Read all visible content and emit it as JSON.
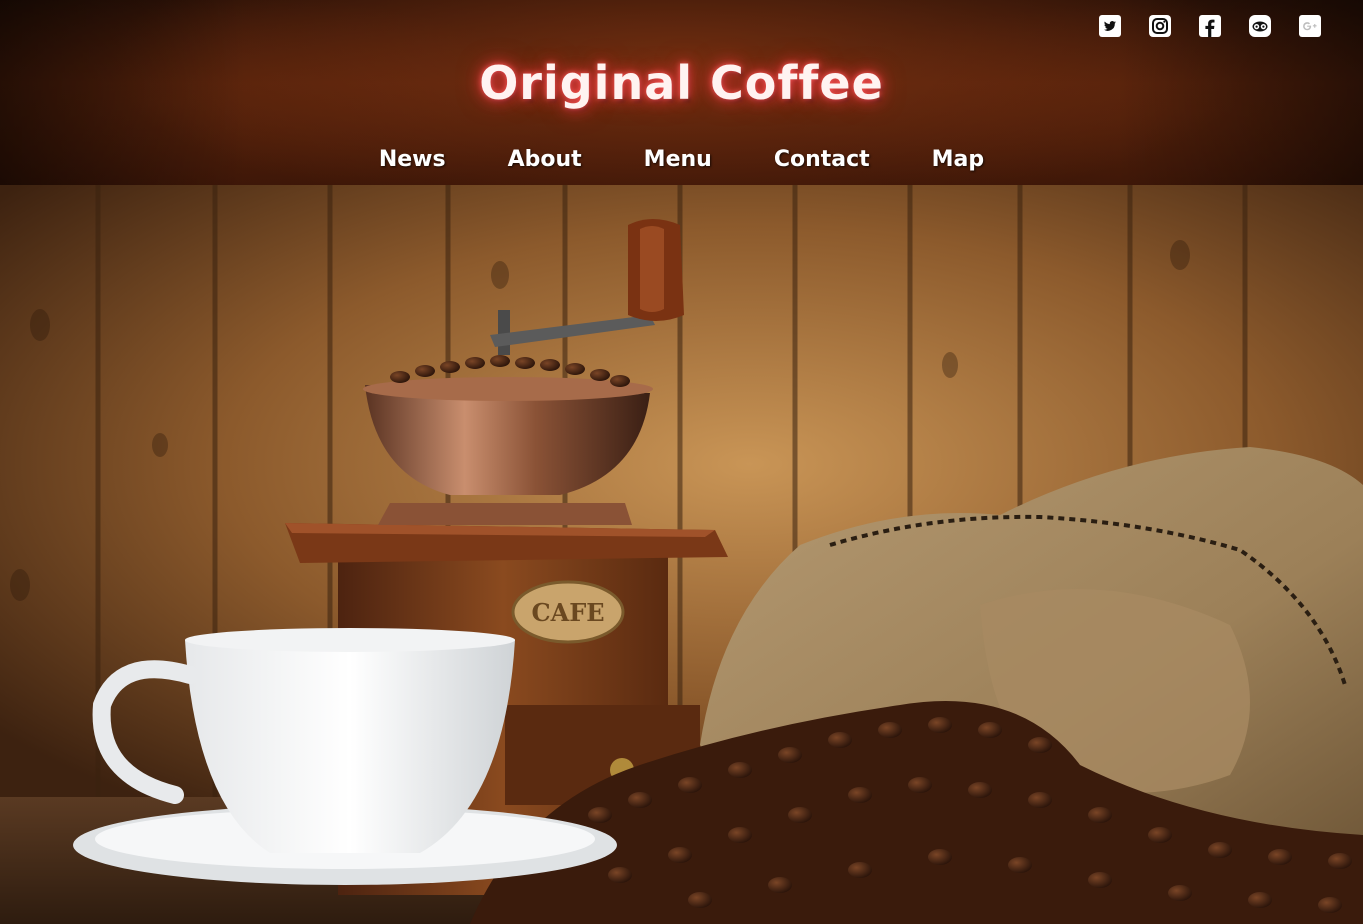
{
  "header": {
    "title": "Original Coffee",
    "nav": [
      {
        "label": "News"
      },
      {
        "label": "About"
      },
      {
        "label": "Menu"
      },
      {
        "label": "Contact"
      },
      {
        "label": "Map"
      }
    ],
    "social_icons": [
      "twitter-icon",
      "instagram-icon",
      "facebook-icon",
      "tripadvisor-icon",
      "google-plus-icon"
    ]
  },
  "hero": {
    "image_subject": "coffee grinder, white cup and burlap sack of coffee beans on wooden table",
    "grinder_plate": "CAFE"
  },
  "colors": {
    "header_bg": "#3a1507",
    "title_glow": "#ff5a5a",
    "title_text": "#fff3f1",
    "nav_text": "#ffffff",
    "wood": "#8a5a2e"
  }
}
